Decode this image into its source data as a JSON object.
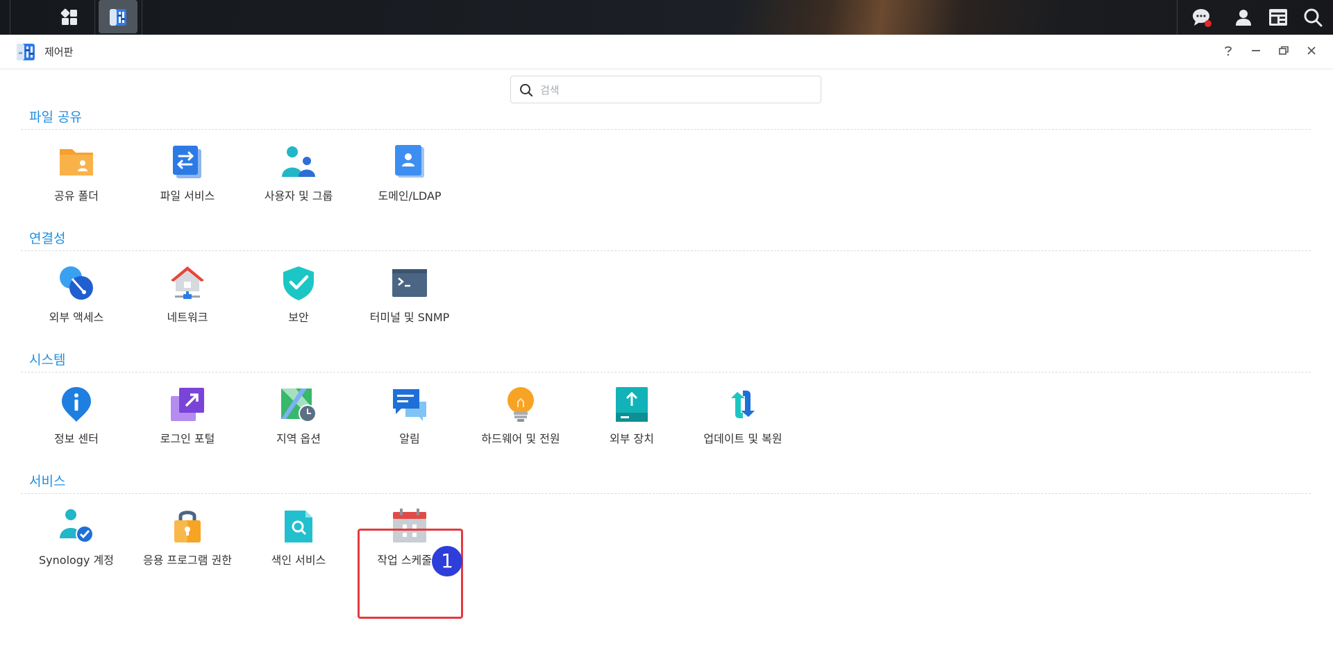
{
  "window": {
    "title": "제어판"
  },
  "search": {
    "placeholder": "검색",
    "value": ""
  },
  "colors": {
    "accent": "#1f8fe0",
    "highlight": "#e43a3f",
    "badge": "#2e3ed8"
  },
  "sections": [
    {
      "title": "파일 공유",
      "items": [
        {
          "label": "공유 폴더",
          "icon": "shared-folder-icon"
        },
        {
          "label": "파일 서비스",
          "icon": "file-services-icon"
        },
        {
          "label": "사용자 및 그룹",
          "icon": "users-groups-icon"
        },
        {
          "label": "도메인/LDAP",
          "icon": "domain-ldap-icon"
        }
      ]
    },
    {
      "title": "연결성",
      "items": [
        {
          "label": "외부 액세스",
          "icon": "external-access-icon"
        },
        {
          "label": "네트워크",
          "icon": "network-icon"
        },
        {
          "label": "보안",
          "icon": "security-shield-icon"
        },
        {
          "label": "터미널 및 SNMP",
          "icon": "terminal-icon"
        }
      ]
    },
    {
      "title": "시스템",
      "items": [
        {
          "label": "정보 센터",
          "icon": "info-center-icon"
        },
        {
          "label": "로그인 포털",
          "icon": "login-portal-icon"
        },
        {
          "label": "지역 옵션",
          "icon": "regional-options-icon"
        },
        {
          "label": "알림",
          "icon": "notification-icon"
        },
        {
          "label": "하드웨어 및 전원",
          "icon": "hardware-power-icon"
        },
        {
          "label": "외부 장치",
          "icon": "external-devices-icon"
        },
        {
          "label": "업데이트 및 복원",
          "icon": "update-restore-icon"
        }
      ]
    },
    {
      "title": "서비스",
      "items": [
        {
          "label": "Synology 계정",
          "icon": "synology-account-icon"
        },
        {
          "label": "응용 프로그램 권한",
          "icon": "app-privileges-icon"
        },
        {
          "label": "색인 서비스",
          "icon": "indexing-service-icon"
        },
        {
          "label": "작업 스케줄러",
          "icon": "task-scheduler-icon"
        }
      ]
    }
  ],
  "annotation": {
    "badge": "1"
  }
}
